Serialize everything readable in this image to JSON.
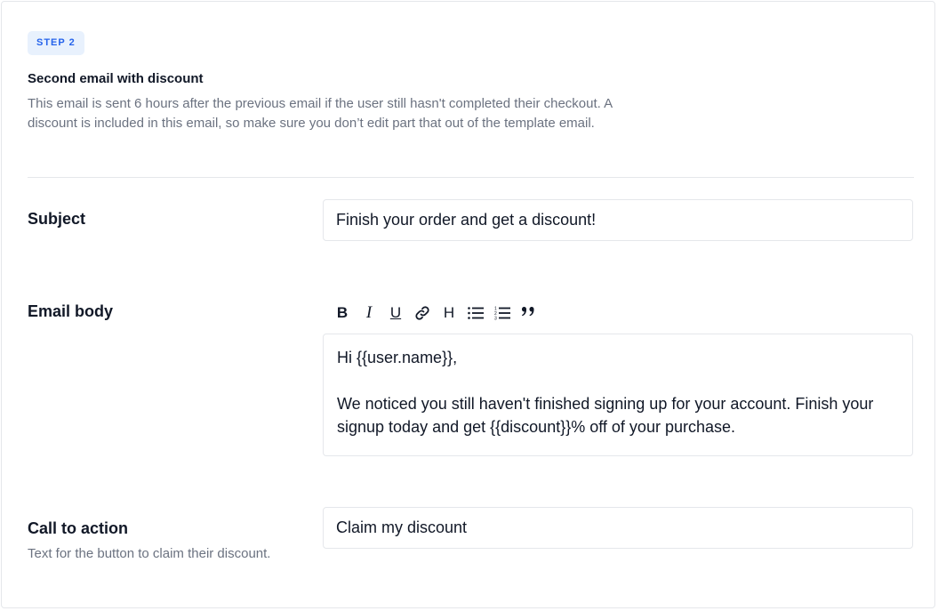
{
  "step": {
    "badge": "STEP 2",
    "title": "Second email with discount",
    "description": "This email is sent 6 hours after the previous email if the user still hasn't completed their checkout. A discount is included in this email, so make sure you don’t edit part that out of the template email."
  },
  "subject": {
    "label": "Subject",
    "value": "Finish your order and get a discount!"
  },
  "email_body": {
    "label": "Email body",
    "toolbar": {
      "bold": "B",
      "italic": "I",
      "underline": "U",
      "heading": "H",
      "icons": [
        "link-icon",
        "bullet-list-icon",
        "numbered-list-icon",
        "quote-icon"
      ]
    },
    "paragraph_1": "Hi {{user.name}},",
    "paragraph_2": "We noticed you still haven't finished signing up for your account. Finish your signup today and get {{discount}}% off of your purchase."
  },
  "cta": {
    "label": "Call to action",
    "description": "Text for the button to claim their discount.",
    "value": "Claim my discount"
  }
}
